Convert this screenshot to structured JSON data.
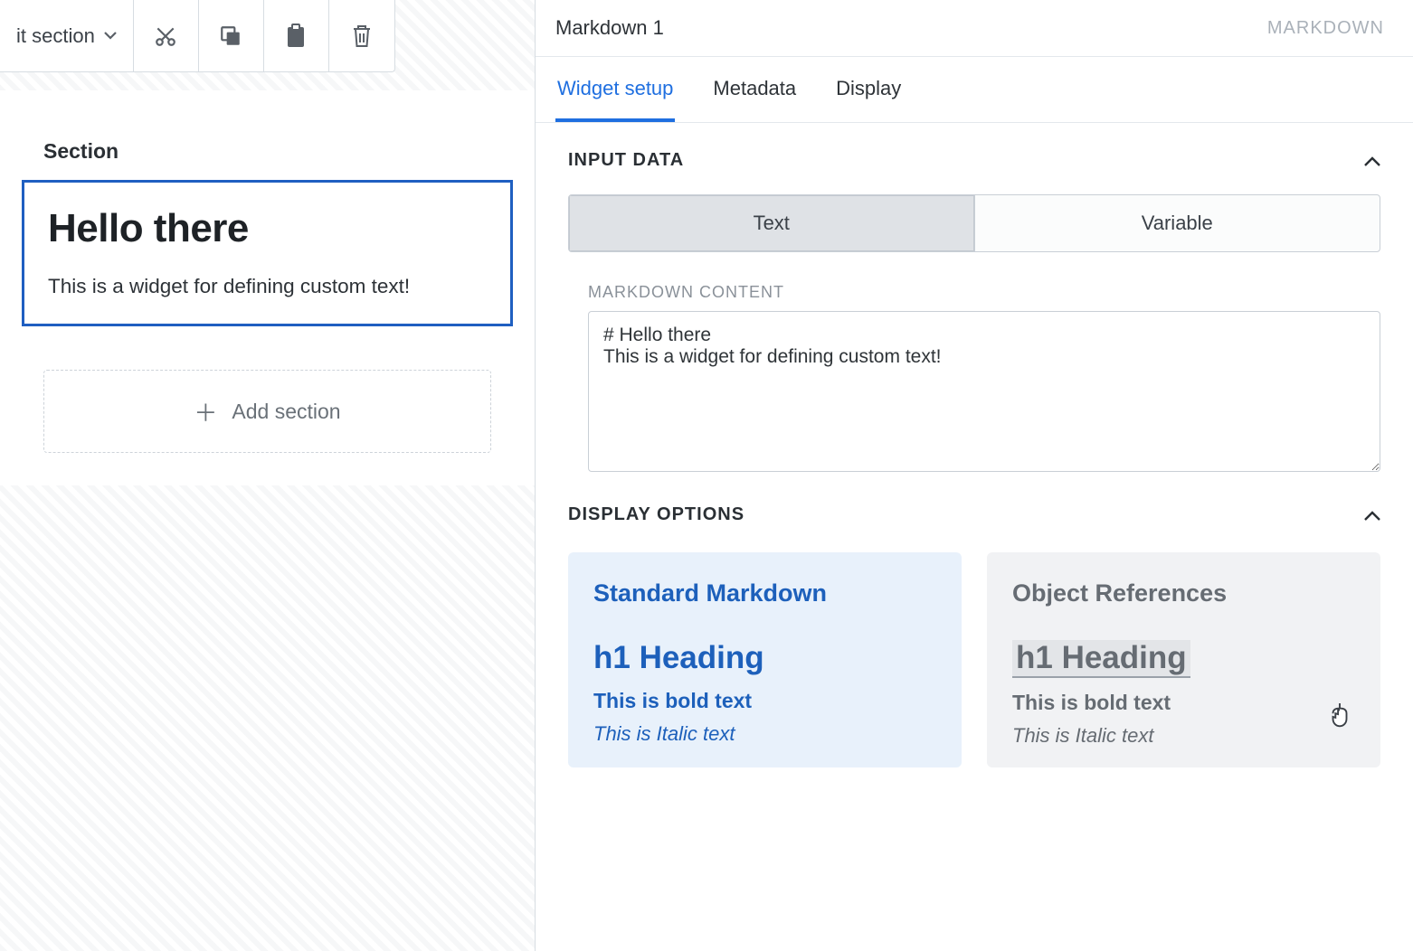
{
  "toolbar": {
    "edit_section": "it section",
    "icons": {
      "cut": "cut-icon",
      "copy": "copy-icon",
      "paste": "paste-icon",
      "trash": "trash-icon"
    }
  },
  "canvas": {
    "section_label": "Section",
    "widget": {
      "heading": "Hello there",
      "body": "This is a widget for defining custom text!"
    },
    "add_section": "Add section"
  },
  "settings": {
    "title": "Markdown 1",
    "type": "MARKDOWN",
    "tabs": {
      "widget_setup": "Widget setup",
      "metadata": "Metadata",
      "display": "Display"
    },
    "groups": {
      "input_data": "INPUT DATA",
      "display_options": "DISPLAY OPTIONS"
    },
    "segments": {
      "text": "Text",
      "variable": "Variable"
    },
    "field_label": "MARKDOWN CONTENT",
    "markdown_value": "# Hello there\nThis is a widget for defining custom text!",
    "options": {
      "standard": {
        "title": "Standard Markdown",
        "h1": "h1 Heading",
        "bold": "This is bold text",
        "italic": "This is Italic text"
      },
      "object_refs": {
        "title": "Object References",
        "h1": "h1 Heading",
        "bold": "This is bold text",
        "italic": "This is Italic text"
      }
    }
  }
}
